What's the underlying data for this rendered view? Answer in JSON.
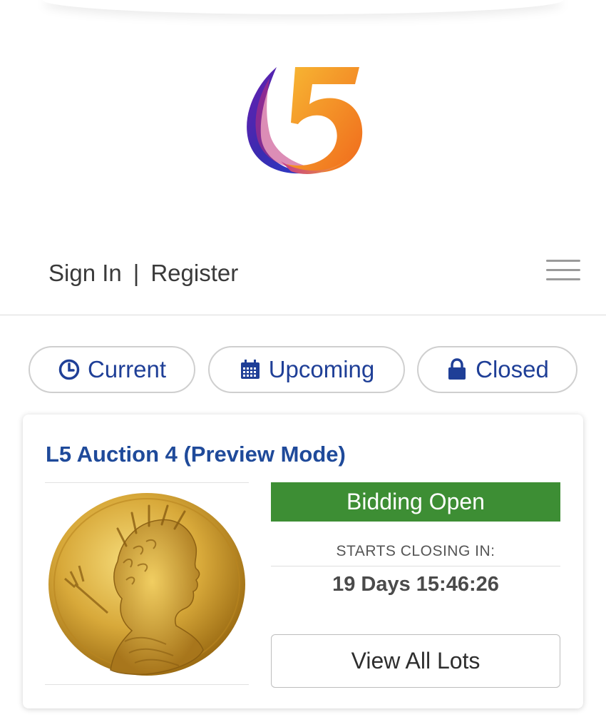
{
  "header": {
    "logo_name": "L5 logo",
    "brand_colors": [
      "#3b2bb0",
      "#8a2a9c",
      "#f5a623",
      "#f08a1c"
    ]
  },
  "auth": {
    "sign_in": "Sign In",
    "separator": "|",
    "register": "Register",
    "menu_icon": "hamburger-icon"
  },
  "filters": [
    {
      "label": "Current",
      "icon": "clock-icon"
    },
    {
      "label": "Upcoming",
      "icon": "calendar-icon"
    },
    {
      "label": "Closed",
      "icon": "lock-icon"
    }
  ],
  "auction": {
    "title": "L5 Auction 4 (Preview Mode)",
    "image": "gold coin with portrait",
    "status": "Bidding Open",
    "status_color": "#3d8e34",
    "closing_label": "STARTS CLOSING IN:",
    "countdown": "19 Days 15:46:26",
    "view_button": "View All Lots"
  },
  "colors": {
    "accent": "#1f3f97",
    "title": "#1f4a9a"
  }
}
